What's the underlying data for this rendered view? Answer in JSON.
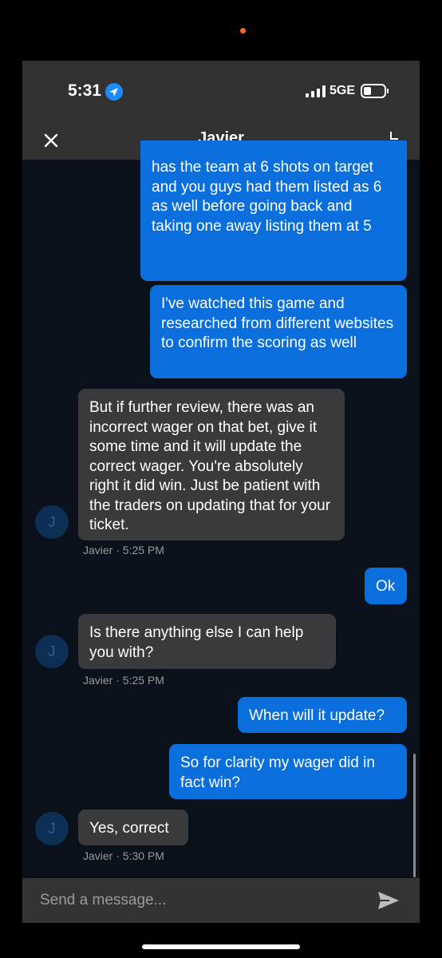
{
  "status_bar": {
    "time": "5:31",
    "network": "5GE",
    "location_icon": "location-arrow-icon",
    "signal_icon": "signal-bars-icon",
    "battery_icon": "battery-icon"
  },
  "header": {
    "title": "Javier",
    "close_icon": "close-icon",
    "collapse_icon": "collapse-icon"
  },
  "messages": [
    {
      "direction": "outgoing",
      "text": "has the team at 6 shots on target and you guys had them listed as 6 as well before going back and taking one away listing them at 5"
    },
    {
      "direction": "outgoing",
      "text": "I've watched this game and researched from different websites to confirm the scoring as well"
    },
    {
      "direction": "incoming",
      "text": "But if further review, there was an incorrect wager on that bet, give it some time and it will update the correct wager. You're absolutely right it did win. Just be patient with the traders on updating that for your ticket.",
      "avatar": "J",
      "meta": "Javier · 5:25 PM"
    },
    {
      "direction": "outgoing",
      "text": "Ok"
    },
    {
      "direction": "incoming",
      "text": "Is there anything else I can help you with?",
      "avatar": "J",
      "meta": "Javier · 5:25 PM"
    },
    {
      "direction": "outgoing",
      "text": "When will it update?"
    },
    {
      "direction": "outgoing",
      "text": "So for clarity my wager did in fact win?"
    },
    {
      "direction": "incoming",
      "text": "Yes, correct",
      "avatar": "J",
      "meta": "Javier · 5:30 PM"
    }
  ],
  "composer": {
    "placeholder": "Send a message...",
    "send_icon": "send-icon"
  },
  "colors": {
    "outgoing_bubble": "#0a6fdd",
    "incoming_bubble": "#3a3a3c",
    "chat_background": "#0b111a",
    "bar_background": "#313131",
    "avatar_background": "#0d2e55"
  }
}
